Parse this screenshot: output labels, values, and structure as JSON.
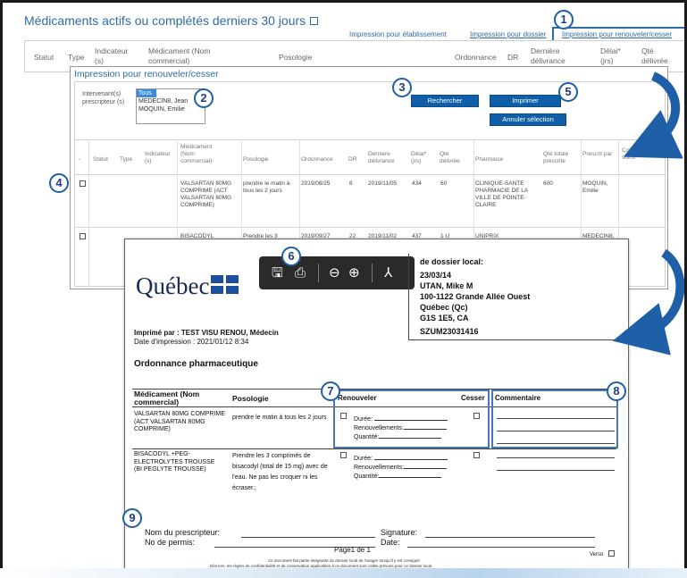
{
  "panel1": {
    "title": "Médicaments actifs ou complétés derniers 30 jours",
    "links": [
      "Impression pour établissement",
      "Impression pour dossier",
      "Impression pour renouveler/cesser"
    ],
    "columns": [
      "Statut",
      "Type",
      "Indicateur (s)",
      "Médicament (Nom commercial)",
      "Posologie",
      "Ordonnance",
      "DR",
      "Dernière délivrance",
      "Délai* (jrs)",
      "Qté délivrée"
    ]
  },
  "panel2": {
    "title": "Impression pour renouveler/cesser",
    "prescriber_label": "Intervenant(s) prescripteur (s)",
    "prescriber_options": [
      "Tous",
      "MEDECIN8, Jean",
      "MOQUIN, Emilie"
    ],
    "selected_prescriber": "Tous",
    "buttons": {
      "search": "Rechercher",
      "print": "Imprimer",
      "cancel": "Annuler sélection"
    },
    "columns": [
      "Statut",
      "Type",
      "Indicateur (s)",
      "Médicament (Nom commercial)",
      "Posologie",
      "Ordonnance",
      "DR",
      "Dernière délivrance",
      "Délai* (jrs)",
      "Qté délivrée",
      "Pharmacie",
      "Qté totale prescrite",
      "Prescrit par",
      "Contexte de soins"
    ],
    "rows": [
      {
        "medicament": "VALSARTAN 80MG COMPRIME (ACT VALSARTAN 80MG COMPRIME)",
        "posologie": "prendre le matin à tous les 2 jours",
        "ordonnance": "2019/08/25",
        "dr": "8",
        "derniere": "2019/11/05",
        "delai": "434",
        "qte": "60",
        "pharmacie": "CLINIQUE-SANTE PHARMACIE DE LA VILLE DE POINTE-CLAIRE",
        "qte_totale": "600",
        "prescrit_par": "MOQUIN, Emilie"
      },
      {
        "medicament": "BISACODYL",
        "posologie": "Prendre les 3",
        "ordonnance": "2019/09/27",
        "dr": "22",
        "derniere": "2019/11/02",
        "delai": "437",
        "qte": "1 U",
        "pharmacie": "UNIPRIX",
        "qte_totale": "",
        "prescrit_par": "MEDECIN8,"
      }
    ]
  },
  "document": {
    "logo": "Québec",
    "local_record_label": "de dossier local:",
    "patient_lines": [
      "23/03/14",
      "UTAN, Mike      M",
      "100-1122 Grande Allée Ouest",
      "Québec (Qc)",
      "G1S 1E5, CA"
    ],
    "patient_id": "SZUM23031416",
    "printed_by": "Imprimé par : TEST VISU RENOU, Médecin",
    "print_date": "Date d'impression : 2021/01/12 8:34",
    "heading": "Ordonnance pharmaceutique",
    "col_med": "Médicament (Nom commercial)",
    "col_poso": "Posologie",
    "col_renew": "Renouveler",
    "col_stop": "Cesser",
    "col_comment": "Commentaire",
    "meds": [
      {
        "name": "VALSARTAN 80MG COMPRIME (ACT VALSARTAN 80MG COMPRIME)",
        "poso": "prendre le matin à tous les 2 jours"
      },
      {
        "name": "BISACODYL +PEG-ELECTROLYTES TROUSSE (BI PEGLYTE TROUSSE)",
        "poso": "Prendre les 3 comprimés de bisacodyl (total de 15 mg) avec de l'eau. Ne pas les croquer ni les écraser.;"
      }
    ],
    "renew_fields": [
      "Durée:",
      "Renouvellements:",
      "Quantité:"
    ],
    "prescriber_name_label": "Nom du prescripteur:",
    "permit_label": "No de permis:",
    "signature_label": "Signature:",
    "date_label": "Date:",
    "page": "Page1 de 1",
    "verso": "Verso",
    "footer1": "Ce document fait partie intégrante du dossier local de l'usager lorsqu'il y est consigné",
    "footer2": "Dès lors, les règles de confidentialité et de conservation applicables à ce document sont celles prévues pour ce dossier local."
  },
  "callouts": [
    "1",
    "2",
    "3",
    "4",
    "5",
    "6",
    "7",
    "8",
    "9"
  ],
  "colors": {
    "accent": "#2e6da4",
    "button": "#0e5fa8",
    "callout_border": "#1f5fa8",
    "arrow": "#1f5fa8"
  }
}
